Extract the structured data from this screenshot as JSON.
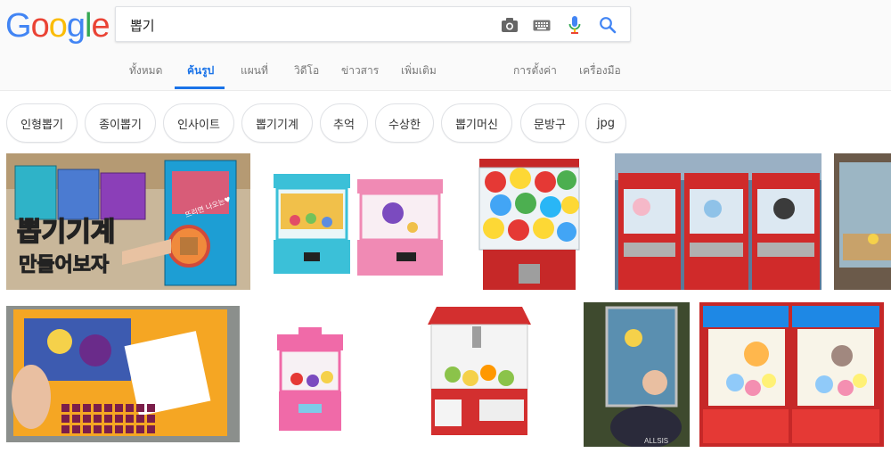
{
  "logo": {
    "letters": [
      "G",
      "o",
      "o",
      "g",
      "l",
      "e"
    ],
    "colors": [
      "#4285F4",
      "#EA4335",
      "#FBBC05",
      "#4285F4",
      "#34A853",
      "#EA4335"
    ]
  },
  "search": {
    "query": "뽑기",
    "icons": [
      "camera-icon",
      "keyboard-icon",
      "microphone-icon",
      "search-icon"
    ]
  },
  "tabs": [
    {
      "label": "ทั้งหมด",
      "active": false
    },
    {
      "label": "ค้นรูป",
      "active": true
    },
    {
      "label": "แผนที่",
      "active": false
    },
    {
      "label": "วิดีโอ",
      "active": false
    },
    {
      "label": "ข่าวสาร",
      "active": false
    },
    {
      "label": "เพิ่มเติม",
      "active": false
    }
  ],
  "tools": {
    "settings": "การตั้งค่า",
    "tools": "เครื่องมือ"
  },
  "chips": [
    "인형뽑기",
    "종이뽑기",
    "인사이트",
    "뽑기기계",
    "추억",
    "수상한",
    "뽑기머신",
    "문방구",
    "jpg"
  ],
  "results": {
    "first_image_text": {
      "line1": "뽑기기계",
      "line2": "만들어보자",
      "badge": "뜨리면 나오는♥"
    },
    "watermark": "ALLSIS"
  },
  "colors": {
    "accent": "#1a73e8",
    "tab_text": "#777777"
  }
}
